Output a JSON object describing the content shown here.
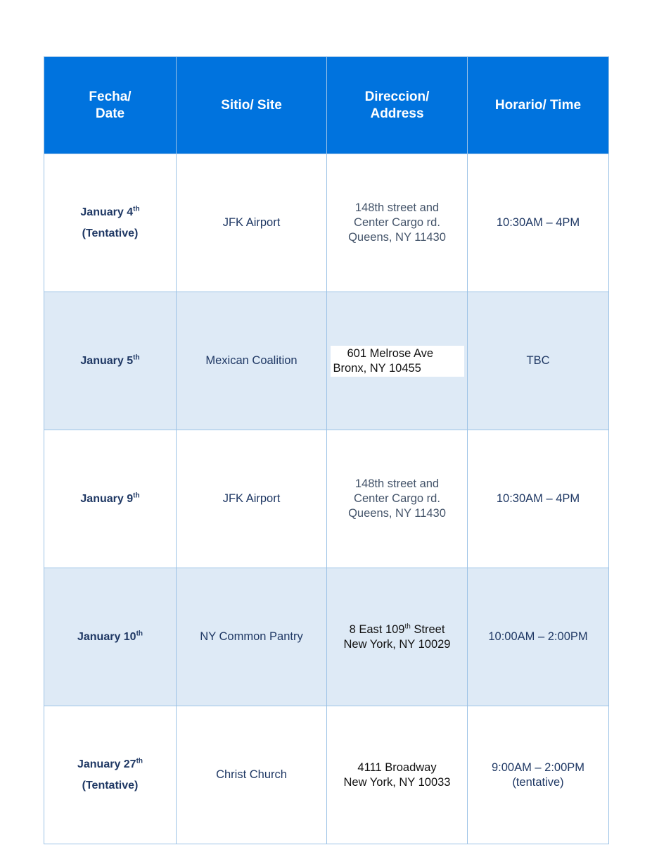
{
  "headers": [
    {
      "l1": "Fecha/",
      "l2": "Date"
    },
    {
      "l1": "Sitio/ Site",
      "l2": ""
    },
    {
      "l1": "Direccion/",
      "l2": "Address"
    },
    {
      "l1": "Horario/ Time",
      "l2": ""
    }
  ],
  "rows": [
    {
      "date": "January 4",
      "sup": "th",
      "note": "(Tentative)",
      "site": "JFK Airport",
      "addr": [
        "148th street and",
        "Center Cargo rd.",
        "Queens, NY 11430"
      ],
      "time": [
        "10:30AM – 4PM"
      ]
    },
    {
      "date": "January 5",
      "sup": "th",
      "note": "",
      "site": "Mexican Coalition",
      "addr": [
        "601 Melrose Ave",
        "Bronx, NY 10455"
      ],
      "time": [
        "TBC"
      ]
    },
    {
      "date": "January 9",
      "sup": "th",
      "note": "",
      "site": "JFK Airport",
      "addr": [
        "148th street and",
        "Center Cargo rd.",
        "Queens, NY 11430"
      ],
      "time": [
        "10:30AM – 4PM"
      ]
    },
    {
      "date": "January 10",
      "sup": "th",
      "note": "",
      "site": "NY Common Pantry",
      "addr_a": "8 East 109",
      "addr_sup": "th",
      "addr_b": " Street",
      "addr": [
        "",
        "New York, NY 10029"
      ],
      "time": [
        "10:00AM – 2:00PM"
      ]
    },
    {
      "date": "January 27",
      "sup": "th",
      "note": "(Tentative)",
      "site": "Christ Church",
      "addr": [
        "4111 Broadway",
        "New York, NY 10033"
      ],
      "time": [
        "9:00AM – 2:00PM",
        "(tentative)"
      ]
    }
  ],
  "colors": {
    "header": "#0073de",
    "border": "#9dc3e6",
    "shade": "#deeaf6",
    "text": "#1f3864"
  }
}
